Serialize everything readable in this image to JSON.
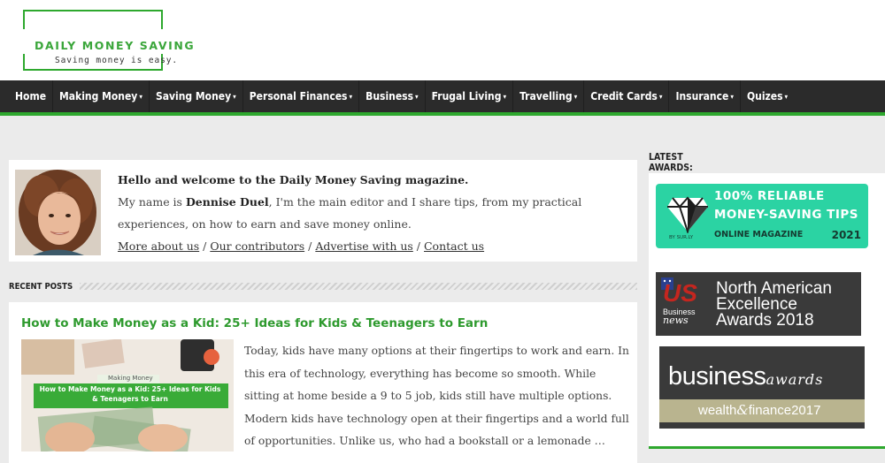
{
  "brand": {
    "name": "DAILY MONEY SAVING",
    "tagline": "Saving money is easy.",
    "accent": "#2ea82e"
  },
  "nav": {
    "items": [
      {
        "label": "Home",
        "dropdown": false
      },
      {
        "label": "Making Money",
        "dropdown": true
      },
      {
        "label": "Saving Money",
        "dropdown": true
      },
      {
        "label": "Personal Finances",
        "dropdown": true
      },
      {
        "label": "Business",
        "dropdown": true
      },
      {
        "label": "Frugal Living",
        "dropdown": true
      },
      {
        "label": "Travelling",
        "dropdown": true
      },
      {
        "label": "Credit Cards",
        "dropdown": true
      },
      {
        "label": "Insurance",
        "dropdown": true
      },
      {
        "label": "Quizes",
        "dropdown": true
      }
    ]
  },
  "welcome": {
    "greeting": "Hello and welcome to the Daily Money Saving magazine.",
    "intro_prefix": "My name is ",
    "editor_name": "Dennise Duel",
    "intro_suffix": ", I'm the main editor and I share tips, from my practical experiences, on how to earn and save money online.",
    "links": [
      "More about us",
      "Our contributors",
      "Advertise with us",
      "Contact us"
    ],
    "separator": " / "
  },
  "recent_posts": {
    "heading": "RECENT POSTS",
    "post": {
      "title": "How to Make Money as a Kid: 25+ Ideas for Kids & Teenagers to Earn",
      "thumb_category": "Making Money",
      "thumb_title": "How to Make Money as a Kid: 25+ Ideas for Kids & Teenagers to Earn",
      "excerpt": "Today, kids have many options at their fingertips to work and earn. In this era of technology, everything has become so smooth. While sitting at home beside a 9 to 5 job, kids still have multiple options. Modern kids have technology open at their fingertips and a world full of opportunities. Unlike us, who had a bookstall or a lemonade …"
    }
  },
  "sidebar": {
    "heading": "LATEST AWARDS:",
    "award1": {
      "line1": "100% RELIABLE",
      "line2": "MONEY-SAVING TIPS",
      "line3": "ONLINE MAGAZINE",
      "year": "2021",
      "by": "BY SUR.LY"
    },
    "award2": {
      "logo": "US",
      "logo_sub1": "Business",
      "logo_sub2": "news",
      "line1": "North American",
      "line2": "Excellence",
      "line3": "Awards 2018"
    },
    "award3": {
      "word1": "business",
      "word2": "awards",
      "line2a": "wealth",
      "line2b": "&",
      "line2c": "finance2017"
    }
  }
}
